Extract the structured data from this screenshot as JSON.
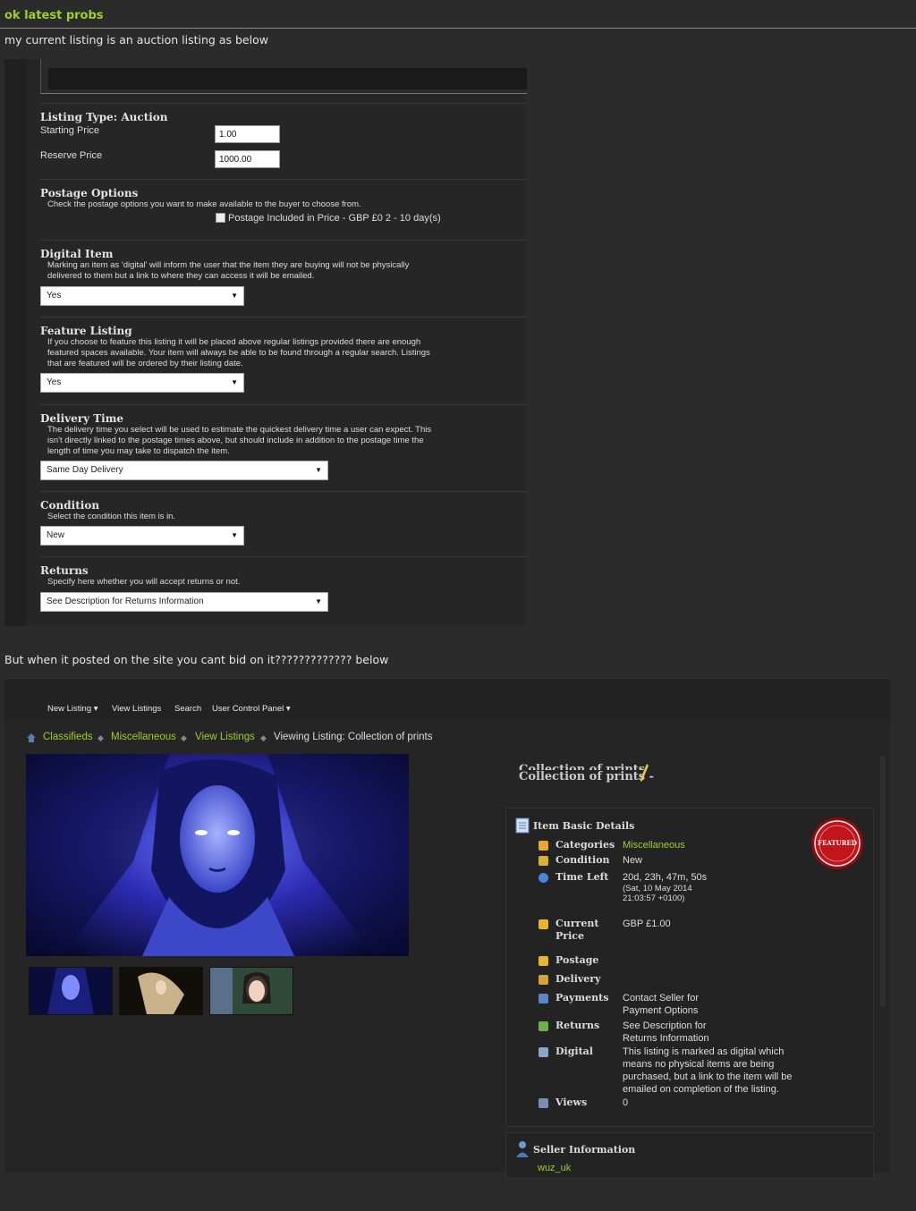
{
  "post": {
    "title": "ok latest probs",
    "intro": "my current listing is an auction listing as below",
    "but_text": "But when it posted on the site you cant bid on it????????????? below"
  },
  "form": {
    "listing_type": "Listing Type: Auction",
    "starting_price_label": "Starting Price",
    "starting_price_value": "1.00",
    "reserve_price_label": "Reserve Price",
    "reserve_price_value": "1000.00",
    "postage": {
      "heading": "Postage Options",
      "desc": "Check the postage options you want to make available to the buyer to choose from.",
      "option": "Postage Included in Price - GBP £0 2 - 10 day(s)"
    },
    "digital": {
      "heading": "Digital Item",
      "desc1": "Marking an item as 'digital' will inform the user that the item they are buying will not be physically",
      "desc2": "delivered to them but a link to where they can access it will be emailed.",
      "value": "Yes"
    },
    "feature": {
      "heading": "Feature Listing",
      "desc1": "If you choose to feature this listing it will be placed above regular listings provided there are enough",
      "desc2": "featured spaces available. Your item will always be able to be found through a regular search. Listings",
      "desc3": "that are featured will be ordered by their listing date.",
      "value": "Yes"
    },
    "delivery": {
      "heading": "Delivery Time",
      "desc1": "The delivery time you select will be used to estimate the quickest delivery time a user can expect. This",
      "desc2": "isn't directly linked to the postage times above, but should include in addition to the postage time the",
      "desc3": "length of time you may take to dispatch the item.",
      "value": "Same Day Delivery"
    },
    "condition": {
      "heading": "Condition",
      "desc": "Select the condition this item is in.",
      "value": "New"
    },
    "returns": {
      "heading": "Returns",
      "desc": "Specify here whether you will accept returns or not.",
      "value": "See Description for Returns Information"
    }
  },
  "site": {
    "nav": [
      "New Listing",
      "View Listings",
      "Search",
      "User Control Panel"
    ],
    "breadcrumb": [
      "Classifieds",
      "Miscellaneous",
      "View Listings"
    ],
    "breadcrumb_current": "Viewing Listing: Collection of prints",
    "listing_title_top": "Collection of prints",
    "listing_title": "Collection of prints -",
    "details_heading": "Item Basic Details",
    "details": {
      "categories_label": "Categories",
      "categories_value": "Miscellaneous",
      "condition_label": "Condition",
      "condition_value": "New",
      "timeleft_label": "Time Left",
      "timeleft_value": "20d, 23h, 47m, 50s",
      "timeleft_sub1": "(Sat, 10 May 2014",
      "timeleft_sub2": "21:03:57 +0100)",
      "price_label1": "Current",
      "price_label2": "Price",
      "price_value": "GBP £1.00",
      "postage_label": "Postage",
      "delivery_label": "Delivery",
      "payments_label": "Payments",
      "payments_value1": "Contact Seller for",
      "payments_value2": "Payment Options",
      "returns_label": "Returns",
      "returns_value1": "See Description for",
      "returns_value2": "Returns Information",
      "digital_label": "Digital",
      "digital_value1": "This listing is marked as digital which",
      "digital_value2": "means no physical items are being",
      "digital_value3": "purchased, but a link to the item will be",
      "digital_value4": "emailed on completion of the listing.",
      "views_label": "Views",
      "views_value": "0"
    },
    "featured_badge": "FEATURED",
    "seller_heading": "Seller Information",
    "seller_name": "wuz_uk"
  },
  "colors": {
    "accent_green": "#9bd12b",
    "badge_red": "#c0151a"
  }
}
